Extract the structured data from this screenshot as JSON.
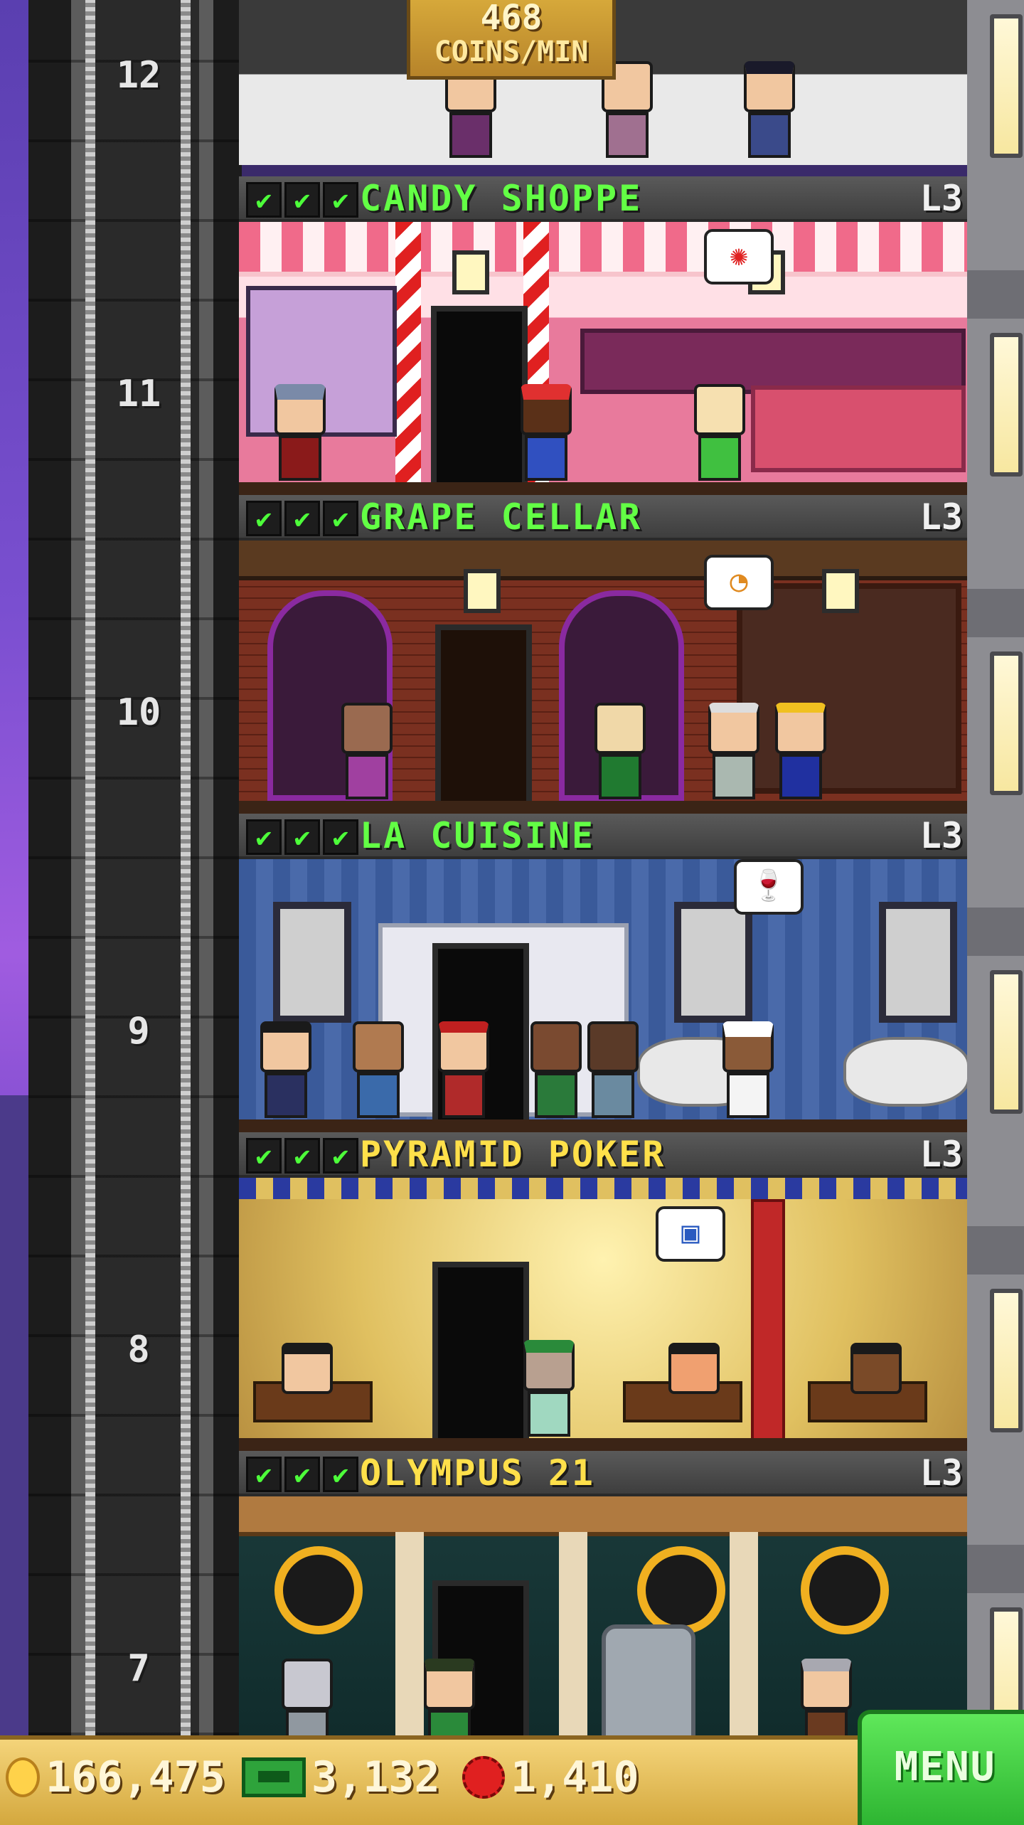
{
  "top_floor": {
    "floor": "12",
    "coins_value": "468",
    "coins_unit": "COINS/MIN"
  },
  "floors": [
    {
      "number": "11",
      "name": "CANDY SHOPPE",
      "level": "L3",
      "checks": [
        "✔",
        "✔",
        "✔"
      ],
      "name_color": "#63ff45"
    },
    {
      "number": "10",
      "name": "GRAPE CELLAR",
      "level": "L3",
      "checks": [
        "✔",
        "✔",
        "✔"
      ],
      "name_color": "#63ff45"
    },
    {
      "number": "9",
      "name": "LA CUISINE",
      "level": "L3",
      "checks": [
        "✔",
        "✔",
        "✔"
      ],
      "name_color": "#63ff45"
    },
    {
      "number": "8",
      "name": "PYRAMID POKER",
      "level": "L3",
      "checks": [
        "✔",
        "✔",
        "✔"
      ],
      "name_color": "#ffe04a"
    },
    {
      "number": "7",
      "name": "OLYMPUS 21",
      "level": "L3",
      "checks": [
        "✔",
        "✔",
        "✔"
      ],
      "name_color": "#ffe04a"
    }
  ],
  "bottom_bar": {
    "coins": "166,475",
    "bux": "3,132",
    "gems": "1,410",
    "coin_icon": "coin-icon",
    "bux_icon": "bux-icon",
    "gem_icon": "gem-icon",
    "menu_label": "MENU"
  },
  "colors": {
    "check_green": "#4dff3a",
    "menu_green": "#2eb532",
    "coin_gold": "#d4a83e"
  }
}
